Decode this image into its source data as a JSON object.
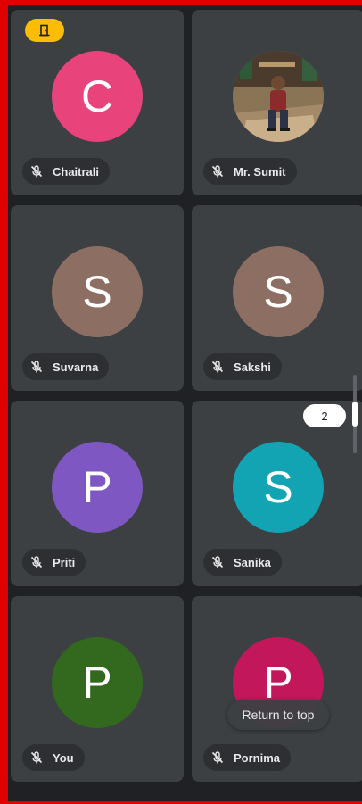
{
  "participants": [
    {
      "name": "Chaitrali",
      "initial": "C",
      "color": "#e8437b",
      "host": true,
      "photo": false
    },
    {
      "name": "Mr. Sumit",
      "initial": "",
      "color": "#7b6a55",
      "host": false,
      "photo": true
    },
    {
      "name": "Suvarna",
      "initial": "S",
      "color": "#8d6e63",
      "host": false,
      "photo": false
    },
    {
      "name": "Sakshi",
      "initial": "S",
      "color": "#8d6e63",
      "host": false,
      "photo": false
    },
    {
      "name": "Priti",
      "initial": "P",
      "color": "#7e57c2",
      "host": false,
      "photo": false
    },
    {
      "name": "Sanika",
      "initial": "S",
      "color": "#12a4b3",
      "host": false,
      "photo": false
    },
    {
      "name": "You",
      "initial": "P",
      "color": "#33691e",
      "host": false,
      "photo": false
    },
    {
      "name": "Pornima",
      "initial": "P",
      "color": "#c2185b",
      "host": false,
      "photo": false
    }
  ],
  "page_indicator": "2",
  "return_to_top_label": "Return to top",
  "icons": {
    "mic": "mic-off-icon",
    "host": "host-door-icon"
  },
  "colors": {
    "background": "#202124",
    "tile": "#3c4043",
    "host_badge": "#fbbc04",
    "frame_border": "#e00000"
  }
}
